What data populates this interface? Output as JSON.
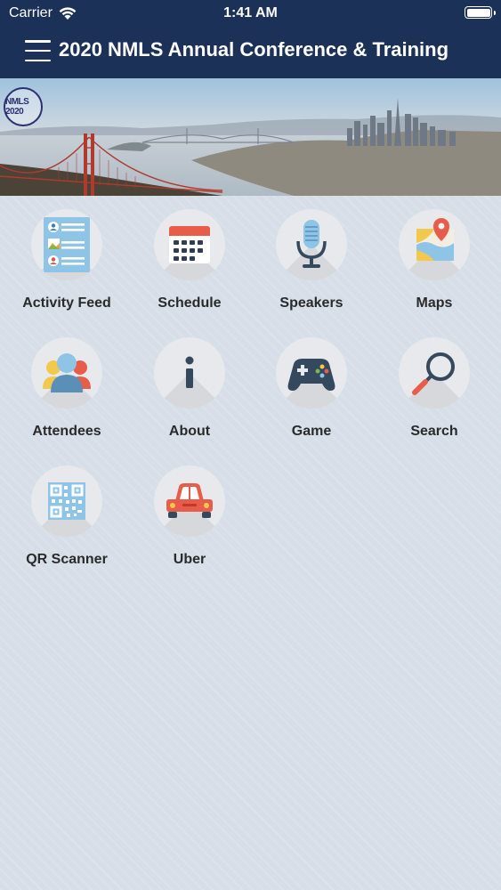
{
  "status_bar": {
    "carrier": "Carrier",
    "time": "1:41 AM"
  },
  "header": {
    "title": "2020 NMLS Annual Conference & Training"
  },
  "banner": {
    "logo_text": "NMLS 2020"
  },
  "tiles": [
    {
      "label": "Activity Feed",
      "icon": "activity-feed-icon"
    },
    {
      "label": "Schedule",
      "icon": "calendar-icon"
    },
    {
      "label": "Speakers",
      "icon": "microphone-icon"
    },
    {
      "label": "Maps",
      "icon": "map-icon"
    },
    {
      "label": "Attendees",
      "icon": "people-icon"
    },
    {
      "label": "About",
      "icon": "info-icon"
    },
    {
      "label": "Game",
      "icon": "gamepad-icon"
    },
    {
      "label": "Search",
      "icon": "magnifier-icon"
    },
    {
      "label": "QR Scanner",
      "icon": "qr-code-icon"
    },
    {
      "label": "Uber",
      "icon": "car-icon"
    }
  ],
  "colors": {
    "header_bg": "#1b3158",
    "page_bg": "#d6dee8",
    "accent_red": "#e85c4a"
  }
}
